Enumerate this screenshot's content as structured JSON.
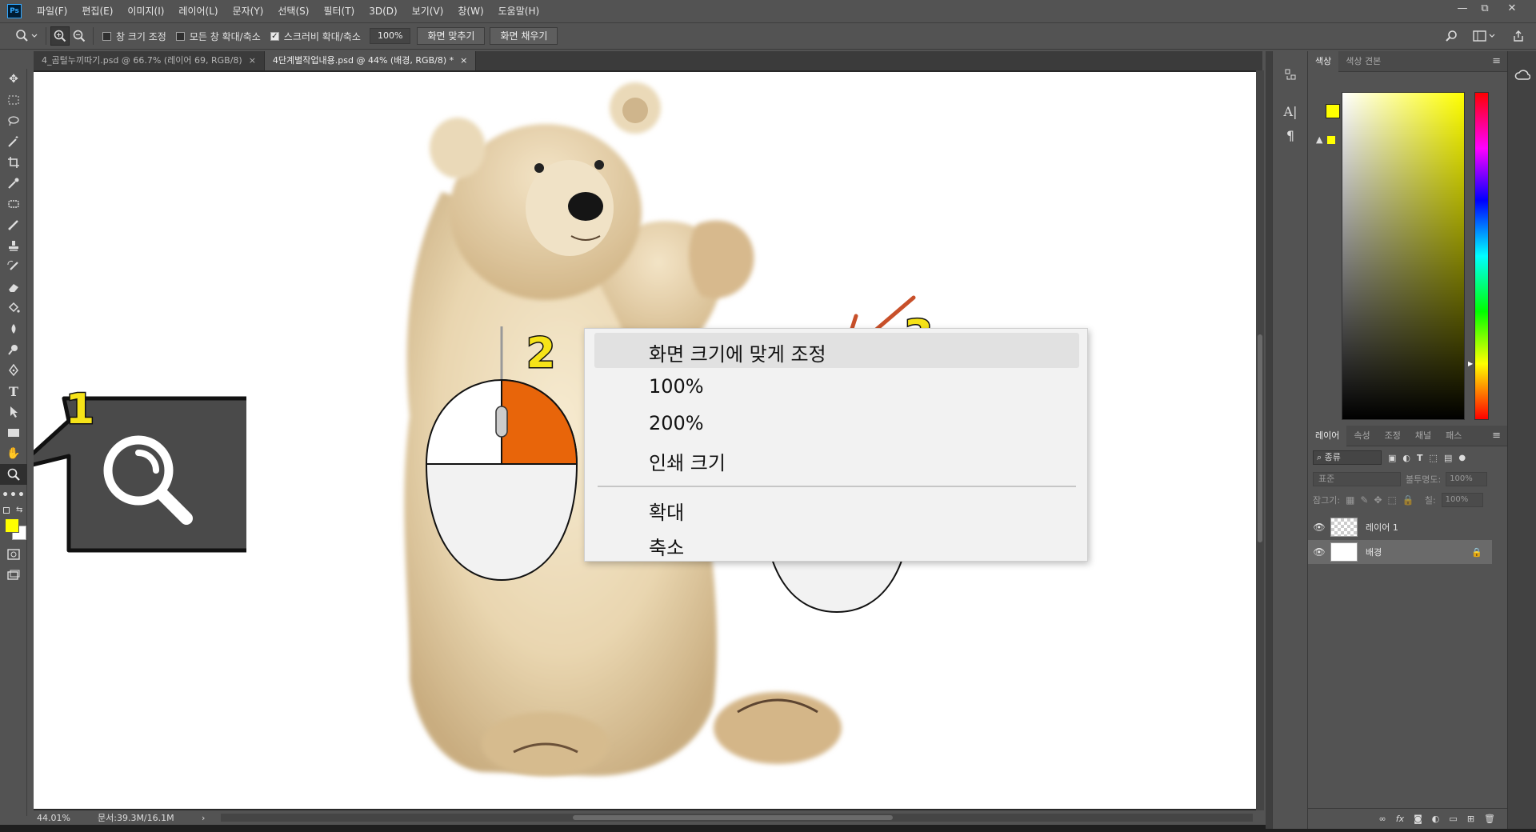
{
  "menubar": {
    "logo": "Ps",
    "items": [
      "파일(F)",
      "편집(E)",
      "이미지(I)",
      "레이어(L)",
      "문자(Y)",
      "선택(S)",
      "필터(T)",
      "3D(D)",
      "보기(V)",
      "창(W)",
      "도움말(H)"
    ]
  },
  "window_controls": {
    "minimize": "—",
    "restore": "⧉",
    "close": "✕"
  },
  "options": {
    "resize_windows": "창 크기 조정",
    "zoom_all_windows": "모든 창 확대/축소",
    "scrubby_zoom": "스크러비 확대/축소",
    "scrubby_zoom_checked": true,
    "zoom_value": "100%",
    "fit_screen": "화면 맞추기",
    "fill_screen": "화면 채우기"
  },
  "tabs": [
    {
      "label": "4_곰털누끼따기.psd @ 66.7% (레이어 69, RGB/8)",
      "close": "×"
    },
    {
      "label": "4단계별작업내용.psd @ 44% (배경, RGB/8) *",
      "close": "×"
    }
  ],
  "status": {
    "zoom": "44.01%",
    "doc": "문서:39.3M/16.1M",
    "arrow": "›"
  },
  "context_menu": {
    "items": [
      "화면 크기에 맞게 조정",
      "100%",
      "200%",
      "인쇄 크기",
      "확대",
      "축소"
    ],
    "highlighted_index": 0
  },
  "callouts": {
    "one": "1",
    "two": "2",
    "three": "3"
  },
  "colors": {
    "foreground": "#ffff00",
    "background": "#ffffff",
    "mouse_button": "#e8650a",
    "checkmark": "#c8502a",
    "callout_number": "#f6e318"
  },
  "color_panel": {
    "tab_color": "색상",
    "tab_swatches": "색상 견본"
  },
  "layers_panel": {
    "tabs": [
      "레이어",
      "속성",
      "조정",
      "채널",
      "패스"
    ],
    "filter_kind": "종류",
    "blend_mode": "표준",
    "opacity_label": "불투명도:",
    "opacity_value": "100%",
    "lock_label": "잠그기:",
    "fill_label": "칠:",
    "fill_value": "100%",
    "layers": [
      {
        "name": "레이어 1",
        "visible": true,
        "locked": false
      },
      {
        "name": "배경",
        "visible": true,
        "locked": true
      }
    ]
  }
}
